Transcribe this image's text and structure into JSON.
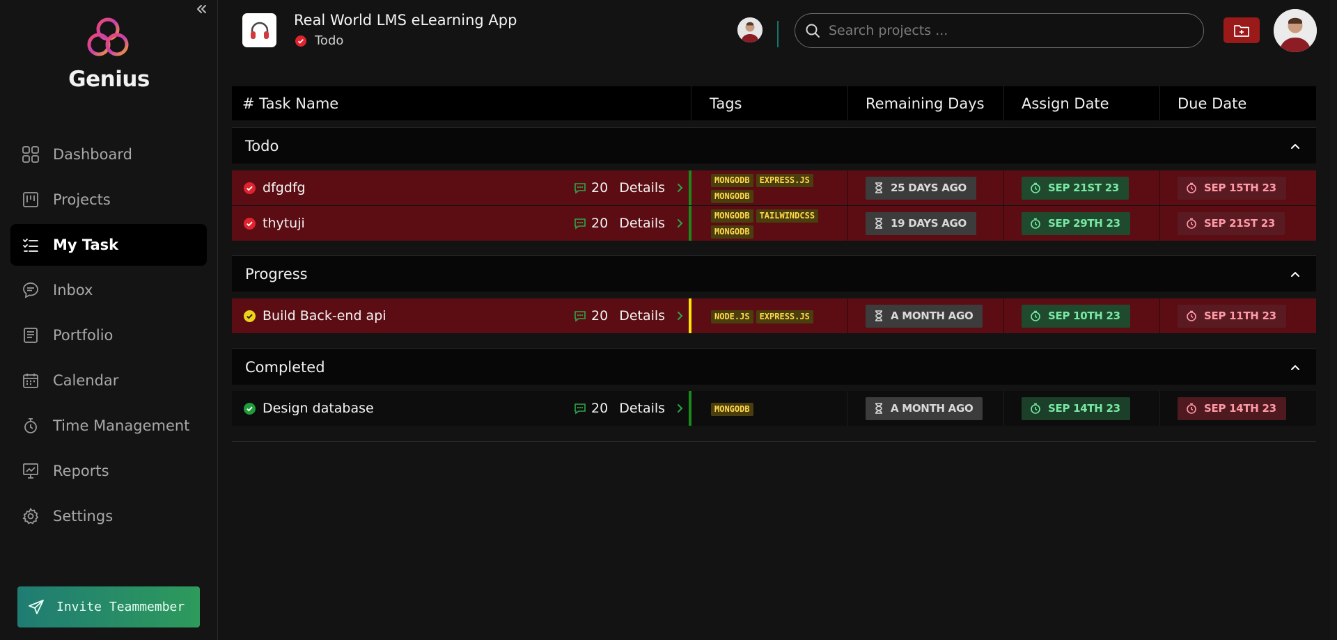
{
  "sidebar": {
    "brand": "Genius",
    "nav": [
      {
        "label": "Dashboard",
        "icon": "grid-icon"
      },
      {
        "label": "Projects",
        "icon": "kanban-icon"
      },
      {
        "label": "My Task",
        "icon": "task-list-icon",
        "active": true
      },
      {
        "label": "Inbox",
        "icon": "chat-icon"
      },
      {
        "label": "Portfolio",
        "icon": "document-icon"
      },
      {
        "label": "Calendar",
        "icon": "calendar-icon"
      },
      {
        "label": "Time Management",
        "icon": "timer-icon"
      },
      {
        "label": "Reports",
        "icon": "chart-icon"
      },
      {
        "label": "Settings",
        "icon": "gear-icon"
      }
    ],
    "invite_label": "Invite Teammember"
  },
  "header": {
    "project_title": "Real World LMS eLearning App",
    "project_status": "Todo",
    "search_placeholder": "Search projects ..."
  },
  "table": {
    "columns": [
      "# Task Name",
      "Tags",
      "Remaining Days",
      "Assign Date",
      "Due Date"
    ],
    "groups": [
      {
        "name": "Todo",
        "rows": [
          {
            "name": "dfgdfg",
            "comments": "20",
            "details": "Details",
            "tags": [
              "MONGODB",
              "EXPRESS.JS",
              "MONGODB"
            ],
            "remaining": "25 DAYS AGO",
            "assign": "SEP 21ST 23",
            "due": "SEP 15TH 23"
          },
          {
            "name": "thytuji",
            "comments": "20",
            "details": "Details",
            "tags": [
              "MONGODB",
              "TAILWINDCSS",
              "MONGODB"
            ],
            "remaining": "19 DAYS AGO",
            "assign": "SEP 29TH 23",
            "due": "SEP 21ST 23"
          }
        ]
      },
      {
        "name": "Progress",
        "rows": [
          {
            "name": "Build Back-end api",
            "comments": "20",
            "details": "Details",
            "tags": [
              "NODE.JS",
              "EXPRESS.JS"
            ],
            "remaining": "A MONTH AGO",
            "assign": "SEP 10TH 23",
            "due": "SEP 11TH 23"
          }
        ]
      },
      {
        "name": "Completed",
        "rows": [
          {
            "name": "Design database",
            "comments": "20",
            "details": "Details",
            "tags": [
              "MONGODB"
            ],
            "remaining": "A MONTH AGO",
            "assign": "SEP 14TH 23",
            "due": "SEP 14TH 23"
          }
        ]
      }
    ]
  },
  "colors": {
    "accent_red": "#9a1a1a",
    "row_red": "#5c0d13",
    "tag_yellow": "#ffd84a",
    "status_todo": "#e0242f",
    "status_progress": "#f0d21a",
    "status_done": "#1f9d3a"
  }
}
